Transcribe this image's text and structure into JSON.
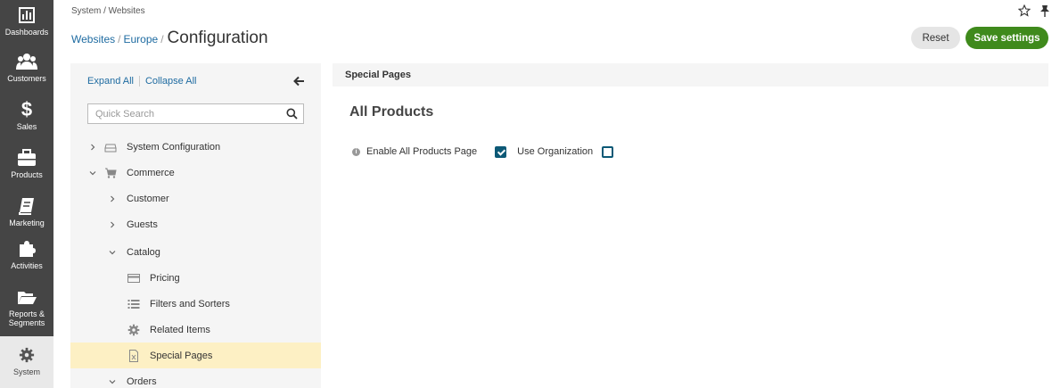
{
  "nav": [
    {
      "label": "Dashboards",
      "icon": "bar-chart-icon"
    },
    {
      "label": "Customers",
      "icon": "users-icon"
    },
    {
      "label": "Sales",
      "icon": "dollar-icon"
    },
    {
      "label": "Products",
      "icon": "briefcase-icon"
    },
    {
      "label": "Marketing",
      "icon": "book-icon"
    },
    {
      "label": "Activities",
      "icon": "puzzle-icon"
    },
    {
      "label_line1": "Reports &",
      "label_line2": "Segments",
      "icon": "folder-open-icon"
    },
    {
      "label": "System",
      "icon": "gear-icon"
    }
  ],
  "header": {
    "top_crumb": "System / Websites",
    "crumb_websites": "Websites",
    "crumb_sep1": "/",
    "crumb_europe": "Europe",
    "crumb_sep2": "/",
    "title": "Configuration",
    "reset_label": "Reset",
    "save_label": "Save settings"
  },
  "tree": {
    "expand_all": "Expand All",
    "collapse_all": "Collapse All",
    "search_placeholder": "Quick Search",
    "items": [
      {
        "label": "System Configuration",
        "icon": "drive-icon",
        "state": "collapsed"
      },
      {
        "label": "Commerce",
        "icon": "cart-icon",
        "state": "expanded"
      },
      {
        "label": "Customer",
        "state": "collapsed"
      },
      {
        "label": "Guests",
        "state": "collapsed"
      },
      {
        "label": "Catalog",
        "state": "expanded"
      },
      {
        "label": "Pricing",
        "icon": "credit-card-icon"
      },
      {
        "label": "Filters and Sorters",
        "icon": "list-icon"
      },
      {
        "label": "Related Items",
        "icon": "gear-icon"
      },
      {
        "label": "Special Pages",
        "icon": "document-icon",
        "selected": true
      },
      {
        "label": "Orders",
        "state": "expanded"
      }
    ]
  },
  "main": {
    "section_title": "Special Pages",
    "group_title": "All Products",
    "field_label": "Enable All Products Page",
    "field_checked": true,
    "use_org_label": "Use Organization",
    "use_org_checked": false
  },
  "colors": {
    "nav_bg": "#454545",
    "accent_link": "#1e6ba1",
    "save_green": "#3f8a1c",
    "selected_bg": "#fdf0c4",
    "checkbox": "#0c5976"
  }
}
